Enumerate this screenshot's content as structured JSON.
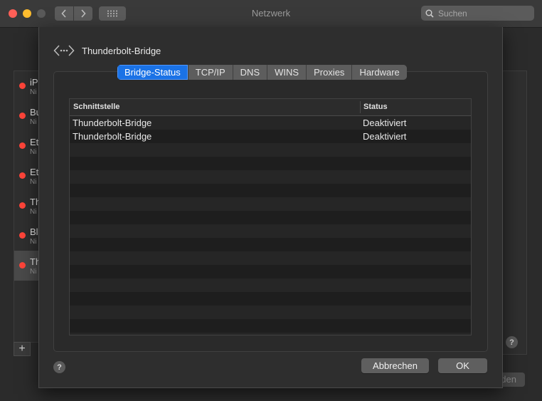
{
  "window": {
    "title": "Netzwerk",
    "search_placeholder": "Suchen"
  },
  "services": [
    {
      "name": "iP",
      "sub": "Ni",
      "status_color": "#ff453a"
    },
    {
      "name": "Bu",
      "sub": "Ni",
      "status_color": "#ff453a"
    },
    {
      "name": "Et",
      "sub": "Ni",
      "status_color": "#ff453a"
    },
    {
      "name": "Et",
      "sub": "Ni",
      "status_color": "#ff453a"
    },
    {
      "name": "Th",
      "sub": "Ni",
      "status_color": "#ff453a"
    },
    {
      "name": "Bl",
      "sub": "Ni",
      "status_color": "#ff453a"
    },
    {
      "name": "Th",
      "sub": "Ni",
      "status_color": "#ff453a",
      "selected": true
    }
  ],
  "background": {
    "add_label": "+",
    "help_label": "?",
    "button_partial": "den"
  },
  "sheet": {
    "title": "Thunderbolt-Bridge",
    "icon": "thunderbolt-bridge-icon",
    "tabs": [
      "Bridge-Status",
      "TCP/IP",
      "DNS",
      "WINS",
      "Proxies",
      "Hardware"
    ],
    "active_tab": "Bridge-Status",
    "table": {
      "headers": [
        "Schnittstelle",
        "Status"
      ],
      "rows": [
        [
          "Thunderbolt-Bridge",
          "Deaktiviert"
        ],
        [
          "Thunderbolt-Bridge",
          "Deaktiviert"
        ]
      ]
    },
    "help_label": "?",
    "cancel_label": "Abbrechen",
    "ok_label": "OK"
  },
  "colors": {
    "accent": "#1a72e6",
    "status_inactive": "#ff453a"
  }
}
